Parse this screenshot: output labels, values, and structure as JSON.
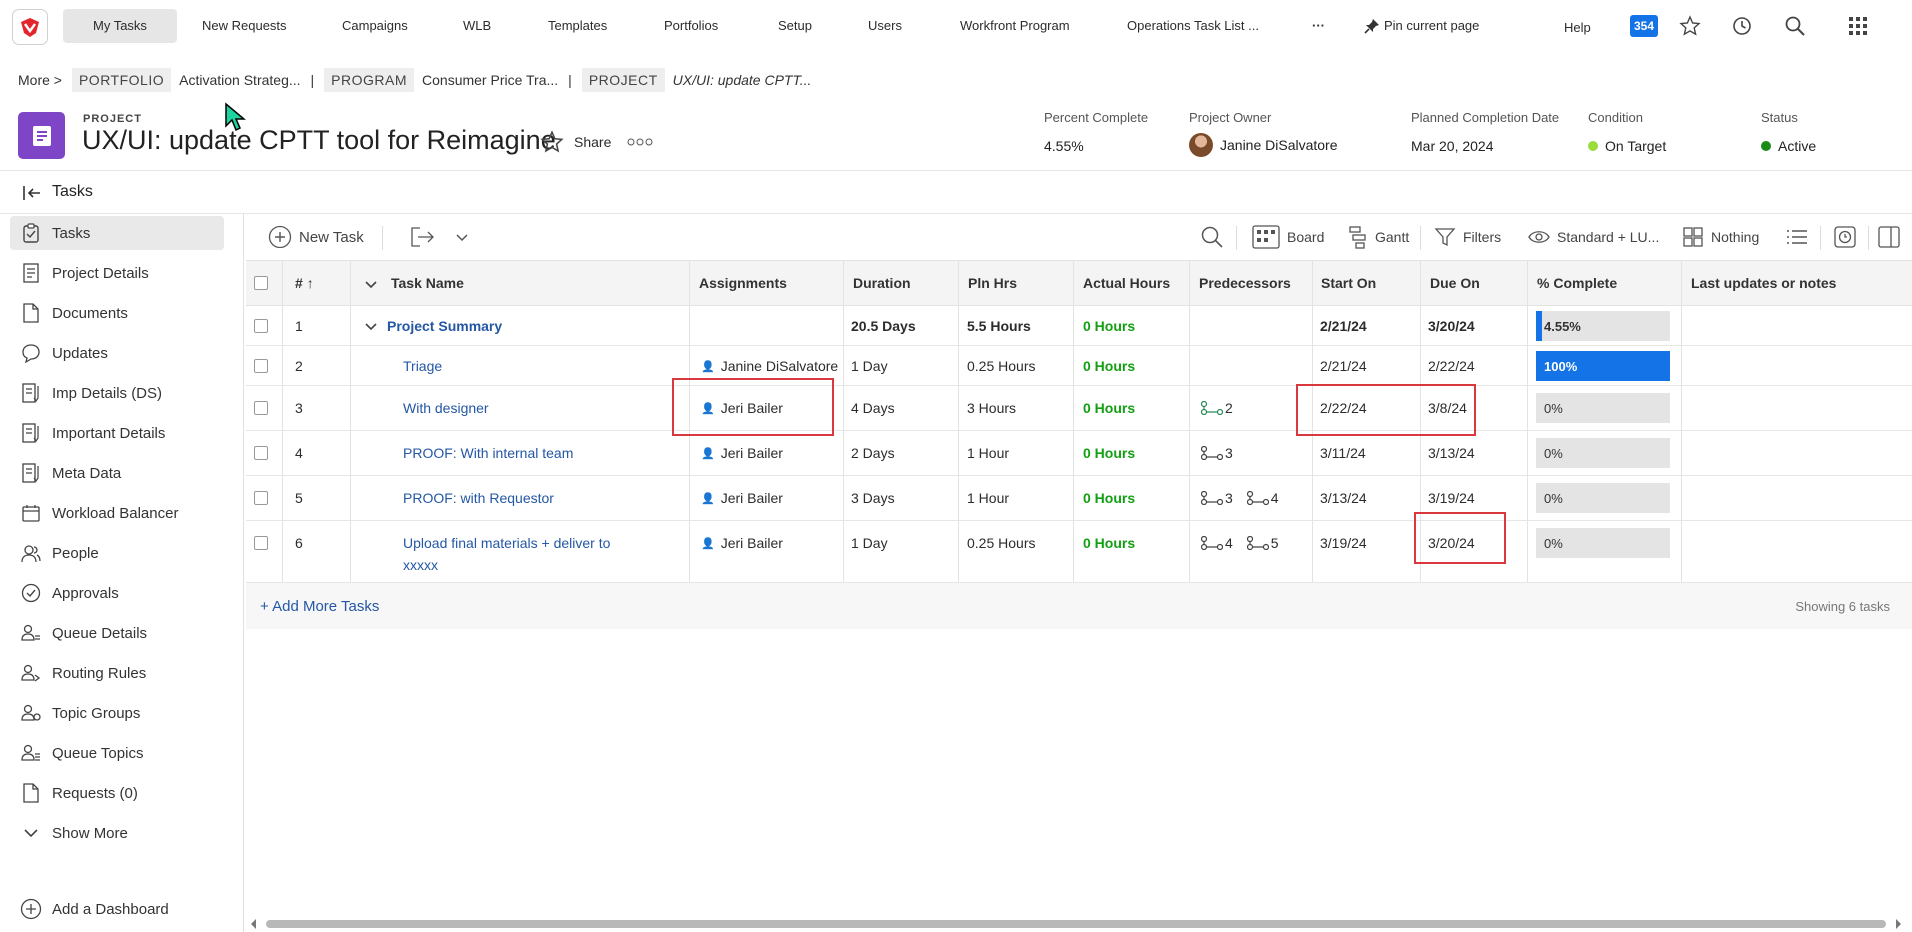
{
  "nav": {
    "items": [
      "My Tasks",
      "New Requests",
      "Campaigns",
      "WLB",
      "Templates",
      "Portfolios",
      "Setup",
      "Users",
      "Workfront Program",
      "Operations Task List ..."
    ],
    "more": "···",
    "pin": "Pin current page",
    "help": "Help",
    "notif_count": "354"
  },
  "breadcrumb": {
    "more": "More >",
    "portfolio_tag": "PORTFOLIO",
    "portfolio": "Activation Strateg...",
    "program_tag": "PROGRAM",
    "program": "Consumer Price Tra...",
    "project_tag": "PROJECT",
    "project": "UX/UI: update CPTT...",
    "sep": "|"
  },
  "project": {
    "label": "PROJECT",
    "title": "UX/UI: update CPTT tool for Reimagine",
    "share": "Share"
  },
  "meta": {
    "percent_label": "Percent Complete",
    "percent": "4.55%",
    "owner_label": "Project Owner",
    "owner": "Janine DiSalvatore",
    "planned_label": "Planned Completion Date",
    "planned": "Mar 20, 2024",
    "condition_label": "Condition",
    "condition": "On Target",
    "condition_color": "#9adc3a",
    "status_label": "Status",
    "status": "Active",
    "status_color": "#1a8a1a"
  },
  "section_title": "Tasks",
  "sidebar": {
    "items": [
      "Tasks",
      "Project Details",
      "Documents",
      "Updates",
      "Imp Details (DS)",
      "Important Details",
      "Meta Data",
      "Workload Balancer",
      "People",
      "Approvals",
      "Queue Details",
      "Routing Rules",
      "Topic Groups",
      "Queue Topics",
      "Requests (0)",
      "Show More"
    ],
    "add_dashboard": "Add a Dashboard"
  },
  "toolbar": {
    "new_task": "New Task",
    "board": "Board",
    "gantt": "Gantt",
    "filters": "Filters",
    "view": "Standard + LU...",
    "grouping": "Nothing"
  },
  "table": {
    "headers": [
      "#",
      "Task Name",
      "Assignments",
      "Duration",
      "Pln Hrs",
      "Actual Hours",
      "Predecessors",
      "Start On",
      "Due On",
      "% Complete",
      "Last updates or notes"
    ],
    "rows": [
      {
        "num": "1",
        "name": "Project Summary",
        "assignee": "",
        "duration": "20.5 Days",
        "pln": "5.5 Hours",
        "actual": "0 Hours",
        "preds": [],
        "start": "2/21/24",
        "due": "3/20/24",
        "pct_label": "4.55%",
        "pct": 4.55
      },
      {
        "num": "2",
        "name": "Triage",
        "assignee": "Janine DiSalvatore",
        "duration": "1 Day",
        "pln": "0.25 Hours",
        "actual": "0 Hours",
        "preds": [],
        "start": "2/21/24",
        "due": "2/22/24",
        "pct_label": "100%",
        "pct": 100
      },
      {
        "num": "3",
        "name": "With designer",
        "assignee": "Jeri Bailer",
        "duration": "4 Days",
        "pln": "3 Hours",
        "actual": "0 Hours",
        "preds": [
          "2"
        ],
        "start": "2/22/24",
        "due": "3/8/24",
        "pct_label": "0%",
        "pct": 0
      },
      {
        "num": "4",
        "name": "PROOF: With internal team",
        "assignee": "Jeri Bailer",
        "duration": "2 Days",
        "pln": "1 Hour",
        "actual": "0 Hours",
        "preds": [
          "3"
        ],
        "start": "3/11/24",
        "due": "3/13/24",
        "pct_label": "0%",
        "pct": 0
      },
      {
        "num": "5",
        "name": "PROOF: with Requestor",
        "assignee": "Jeri Bailer",
        "duration": "3 Days",
        "pln": "1 Hour",
        "actual": "0 Hours",
        "preds": [
          "3",
          "4"
        ],
        "start": "3/13/24",
        "due": "3/19/24",
        "pct_label": "0%",
        "pct": 0
      },
      {
        "num": "6",
        "name_line1": "Upload final materials + deliver to",
        "name_line2": "xxxxx",
        "assignee": "Jeri Bailer",
        "duration": "1 Day",
        "pln": "0.25 Hours",
        "actual": "0 Hours",
        "preds": [
          "4",
          "5"
        ],
        "start": "3/19/24",
        "due": "3/20/24",
        "pct_label": "0%",
        "pct": 0
      }
    ],
    "add_more": "+ Add More Tasks",
    "showing": "Showing 6 tasks"
  }
}
